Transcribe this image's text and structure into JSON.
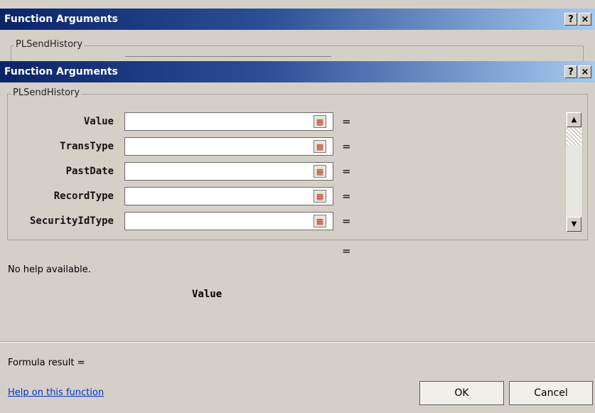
{
  "back_dialog": {
    "title": "Function Arguments",
    "help_btn": "?",
    "close_btn": "×",
    "group_label": "PLSendHistory"
  },
  "dialog": {
    "title": "Function Arguments",
    "help_btn": "?",
    "close_btn": "×",
    "group_label": "PLSendHistory",
    "arguments": [
      {
        "label": "Value",
        "value": ""
      },
      {
        "label": "TransType",
        "value": ""
      },
      {
        "label": "PastDate",
        "value": ""
      },
      {
        "label": "RecordType",
        "value": ""
      },
      {
        "label": "SecurityIdType",
        "value": ""
      }
    ],
    "equals": "=",
    "result_equals": "=",
    "help_text": "No help available.",
    "arg_desc_name": "Value",
    "formula_result": "Formula result =",
    "help_link": "Help on this function",
    "ok_label": "OK",
    "cancel_label": "Cancel"
  }
}
